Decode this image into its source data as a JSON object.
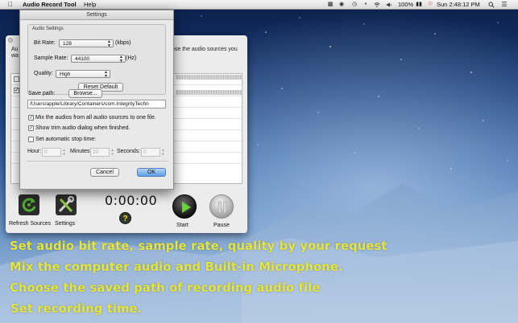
{
  "menubar": {
    "app_name": "Audio Record Tool",
    "help_menu": "Help",
    "battery": "100%",
    "clock": "Sun 2:48:12 PM"
  },
  "main_window": {
    "description_fragment": "ose the audio sources you",
    "left_cut_1": "Au",
    "left_cut_2": "wa",
    "refresh_label": "Refresh Sources",
    "settings_label": "Settings",
    "timer": "0:00:00",
    "help_symbol": "?",
    "start_label": "Start",
    "pause_label": "Pause"
  },
  "settings": {
    "title": "Settings",
    "group_title": "Audio Settings",
    "bit_rate_label": "Bit Rate:",
    "bit_rate_value": "128",
    "bit_rate_unit": "(kbps)",
    "sample_rate_label": "Sample Rate:",
    "sample_rate_value": "44100",
    "sample_rate_unit": "(Hz)",
    "quality_label": "Quality:",
    "quality_value": "High",
    "reset_label": "Reset Default",
    "save_path_label": "Save path:",
    "browse_label": "Browse...",
    "save_path_value": "/Users/apple/Library/Containers/com.IntegrityTechn",
    "mix_label": "Mix the audios from all audio sources to one file.",
    "mix_checked": true,
    "trim_label": "Show trim audio dialog when finished.",
    "trim_checked": true,
    "auto_stop_label": "Set automatic stop time:",
    "auto_stop_checked": false,
    "hour_label": "Hour:",
    "hour_value": "0",
    "minutes_label": "Minutes:",
    "minutes_value": "20",
    "seconds_label": "Seconds:",
    "seconds_value": "0",
    "cancel_label": "Cancel",
    "ok_label": "OK"
  },
  "promo_lines": [
    "Set audio bit rate, sample rate, quality by your request",
    "Mix the computer audio and Built-in Microphone.",
    "Choose the saved path of recording audio file",
    "Set recording time."
  ],
  "colors": {
    "promo_text": "#e4e63c",
    "default_button": "#5d9ce6",
    "refresh_icon": "#3a7a2a",
    "start_button": "#111111"
  },
  "icons": {
    "apple": "apple-icon",
    "wifi": "wifi-icon",
    "bluetooth": "bluetooth-icon",
    "volume": "volume-icon",
    "spotlight": "spotlight-icon",
    "notification": "notification-center-icon"
  }
}
